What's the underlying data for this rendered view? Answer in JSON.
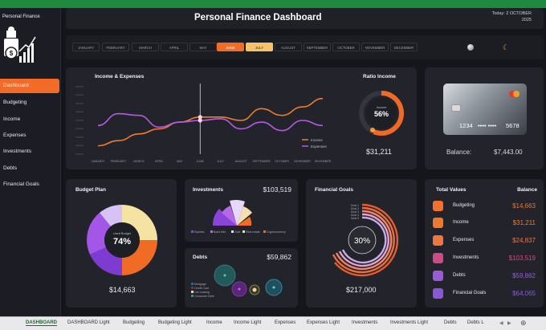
{
  "sidebar": {
    "title": "Personal Finance",
    "items": [
      {
        "label": "Dashboard",
        "active": true
      },
      {
        "label": "Budgeting"
      },
      {
        "label": "Income"
      },
      {
        "label": "Expenses"
      },
      {
        "label": "Investments"
      },
      {
        "label": "Debts"
      },
      {
        "label": "Financial Goals"
      }
    ]
  },
  "header": {
    "title": "Personal Finance Dashboard",
    "today_line1": "Today: 2 OCTOBER",
    "today_line2": "2025"
  },
  "months": [
    "JANUARY",
    "FEBRUARY",
    "MARCH",
    "APRIL",
    "MAY",
    "JUNE",
    "JULY",
    "AUGUST",
    "SEPTEMBER",
    "OCTOBER",
    "NOVEMBER",
    "DECEMBER"
  ],
  "month_highlight": {
    "orange": "JUNE",
    "yellow": "JULY"
  },
  "income_expenses": {
    "title": "Income & Expenses",
    "legend_income": "Income",
    "legend_expenses": "Expenses"
  },
  "chart_data": {
    "type": "line",
    "x": [
      "JANUARY",
      "FEBRUARY",
      "MARCH",
      "APRIL",
      "MAY",
      "JUNE",
      "JULY",
      "AUGUST",
      "SEPTEMBER",
      "OCTOBER",
      "NOVEMBER",
      "DECEMBER"
    ],
    "series": [
      {
        "name": "Income",
        "color": "#f07c2a",
        "values": [
          5,
          8,
          12,
          15,
          19,
          22,
          22,
          20,
          27,
          23,
          28,
          33
        ]
      },
      {
        "name": "Expenses",
        "color": "#b55be0",
        "values": [
          17,
          24,
          23,
          16,
          19,
          20,
          21,
          15,
          19,
          14,
          20,
          17
        ]
      }
    ],
    "ylim": [
      0,
      40
    ],
    "grid": false,
    "legend": "bottom-right"
  },
  "ratio_income": {
    "title": "Ratio Income",
    "label": "Income",
    "percent": "56%",
    "fraction": 0.56,
    "value": "$31,211"
  },
  "card": {
    "number_left": "1234",
    "number_right": "5678",
    "balance_label": "Balance:",
    "balance_value": "$7,443.00"
  },
  "budget_plan": {
    "title": "Budget Plan",
    "center_label": "Used Budget",
    "percent": "74%",
    "value": "$14,663"
  },
  "investments": {
    "title": "Investments",
    "value": "$103,519",
    "legend": [
      "Equities",
      "Bond Mkt.",
      "Gold",
      "Real estate",
      "Cryptocurrency"
    ]
  },
  "debts": {
    "title": "Debts",
    "value": "$59,862",
    "legend": [
      "Mortgage",
      "Credit Card",
      "Car Leasing",
      "Consumer Debt"
    ]
  },
  "financial_goals": {
    "title": "Financial Goals",
    "percent": "30%",
    "value": "$217,000",
    "goals": [
      "Goal 1",
      "Goal 2",
      "Goal 3",
      "Goal 4",
      "Goal 5"
    ]
  },
  "total_values": {
    "title": "Total Values",
    "balance_header": "Balance",
    "rows": [
      {
        "label": "Budgeting",
        "value": "$14,663",
        "color": "#f2722b"
      },
      {
        "label": "Income",
        "value": "$31,211",
        "color": "#f07a2c"
      },
      {
        "label": "Expenses",
        "value": "$24,837",
        "color": "#ee7640"
      },
      {
        "label": "Investments",
        "value": "$103,519",
        "color": "#d04a86"
      },
      {
        "label": "Debts",
        "value": "$59,862",
        "color": "#9a5bd8"
      },
      {
        "label": "Financial Goals",
        "value": "$64,065",
        "color": "#8a58d6"
      }
    ]
  },
  "sheet_tabs": [
    "DASHBOARD",
    "DASHBOARD Light",
    "Budgeting",
    "Budgeting Light",
    "Income",
    "Income Light",
    "Expenses",
    "Expenses Light",
    "Investments",
    "Investments Light",
    "Debts",
    "Debts L"
  ]
}
